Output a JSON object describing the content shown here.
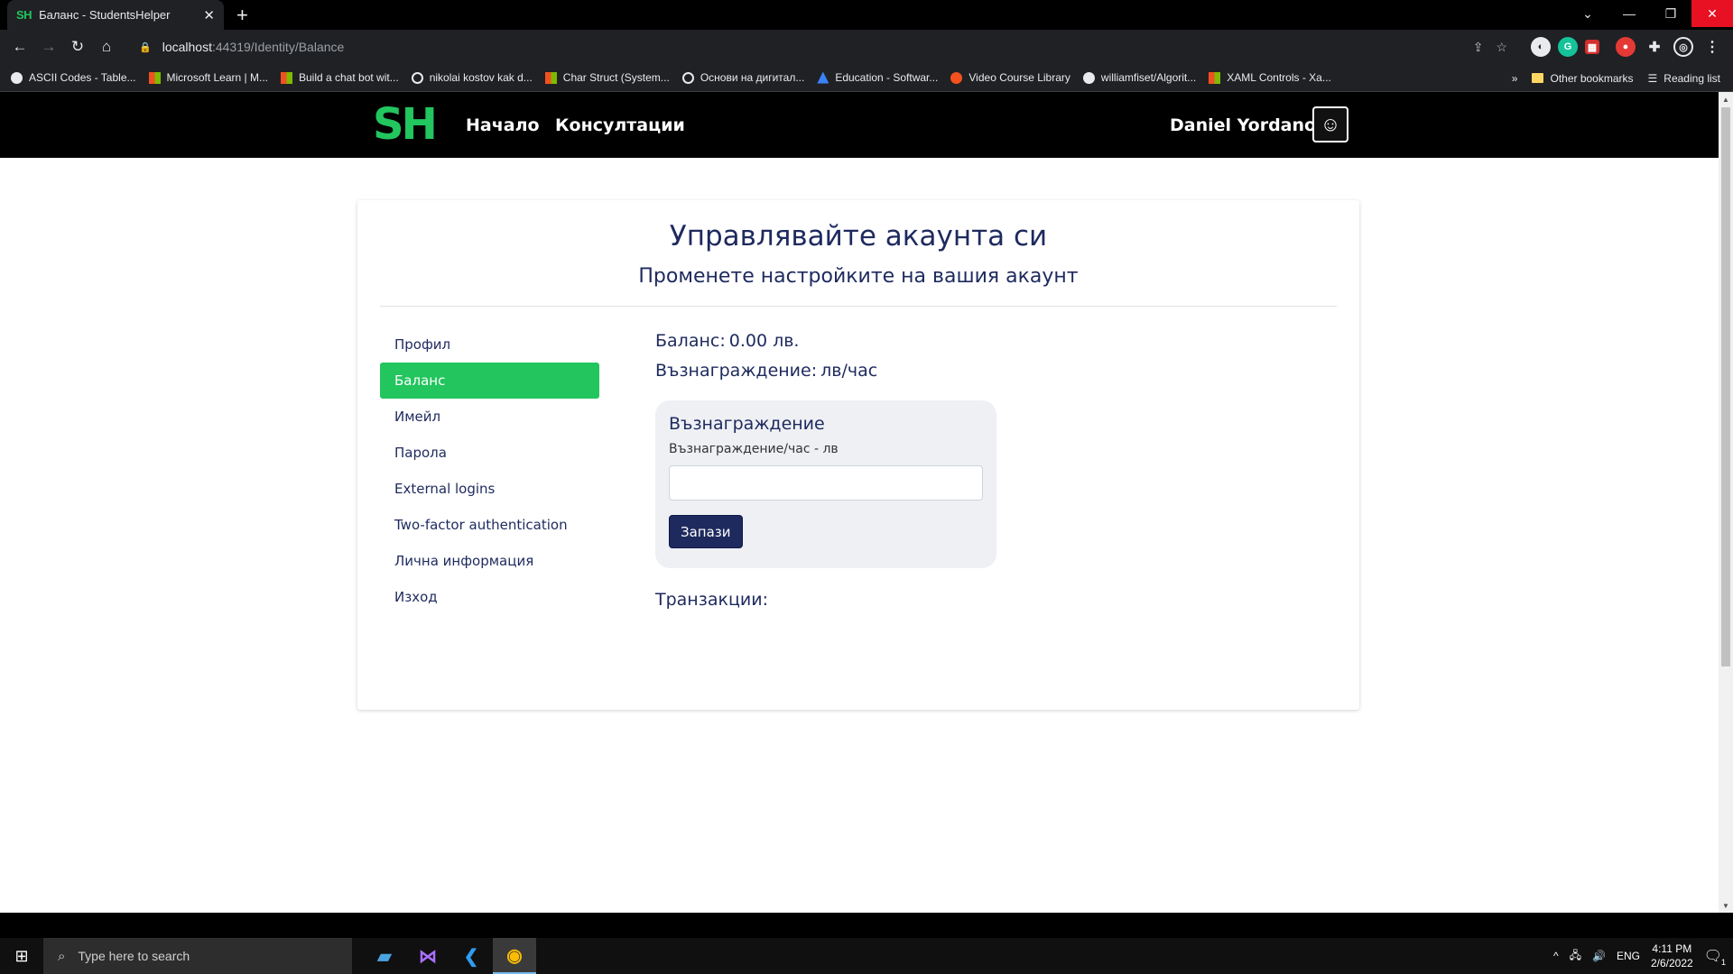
{
  "browser": {
    "tab_title": "Баланс - StudentsHelper",
    "tab_favicon": "SH",
    "url_host": "localhost",
    "url_path": ":44319/Identity/Balance",
    "bookmarks": [
      "ASCII Codes - Table...",
      "Microsoft Learn | M...",
      "Build a chat bot wit...",
      "nikolai kostov kak d...",
      "Char Struct (System...",
      "Основи на дигитал...",
      "Education - Softwar...",
      "Video Course Library",
      "williamfiset/Algorit...",
      "XAML Controls - Xa..."
    ],
    "other_bookmarks": "Other bookmarks",
    "reading_list": "Reading list",
    "overflow": "»"
  },
  "site": {
    "logo": "SH",
    "nav": {
      "home": "Начало",
      "consultations": "Консултации"
    },
    "user_name": "Daniel Yordanov"
  },
  "page": {
    "title": "Управлявайте акаунта си",
    "subtitle": "Променете настройките на вашия акаунт",
    "sidebar": [
      {
        "label": "Профил",
        "active": false
      },
      {
        "label": "Баланс",
        "active": true
      },
      {
        "label": "Имейл",
        "active": false
      },
      {
        "label": "Парола",
        "active": false
      },
      {
        "label": "External logins",
        "active": false
      },
      {
        "label": "Two-factor authentication",
        "active": false
      },
      {
        "label": "Лична информация",
        "active": false
      },
      {
        "label": "Изход",
        "active": false
      }
    ],
    "balance_label": "Баланс:",
    "balance_value": "0.00 лв.",
    "reward_label": "Възнаграждение:",
    "reward_value": "лв/час",
    "reward_form": {
      "heading": "Възнаграждение",
      "field_label": "Възнаграждение/час - лв",
      "field_value": "",
      "save_label": "Запази"
    },
    "transactions_label": "Транзакции:"
  },
  "taskbar": {
    "search_placeholder": "Type here to search",
    "language": "ENG",
    "time": "4:11 PM",
    "date": "2/6/2022",
    "notifications": "1"
  },
  "colors": {
    "brand_green": "#22c55e",
    "navy": "#1e2a5e"
  }
}
